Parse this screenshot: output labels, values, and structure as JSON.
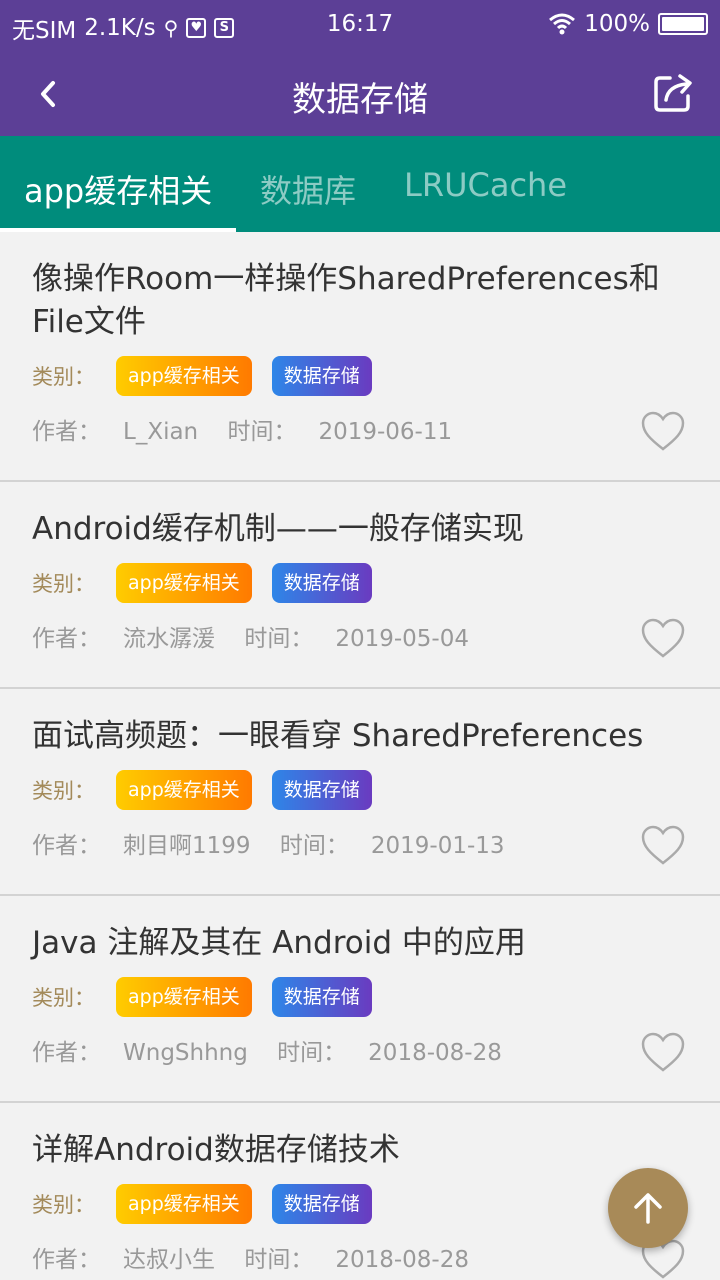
{
  "status_bar": {
    "carrier": "无SIM",
    "speed": "2.1K/s",
    "box_icon_1": "♥",
    "box_icon_2": "S",
    "time": "16:17",
    "battery": "100%"
  },
  "header": {
    "title": "数据存储",
    "back_icon": "chevron-left-icon",
    "share_icon": "share-icon"
  },
  "tabs": [
    {
      "label": "app缓存相关",
      "active": true
    },
    {
      "label": "数据库",
      "active": false
    },
    {
      "label": "LRUCache",
      "active": false
    }
  ],
  "category_label": "类别：",
  "author_prefix": "作者：",
  "time_prefix": "时间：",
  "articles": [
    {
      "title": "像操作Room一样操作SharedPreferences和File文件",
      "tags": [
        "app缓存相关",
        "数据存储"
      ],
      "author": "L_Xian",
      "date": "2019-06-11"
    },
    {
      "title": "Android缓存机制——一般存储实现",
      "tags": [
        "app缓存相关",
        "数据存储"
      ],
      "author": "流水潺湲",
      "date": "2019-05-04"
    },
    {
      "title": "面试高频题：一眼看穿 SharedPreferences",
      "tags": [
        "app缓存相关",
        "数据存储"
      ],
      "author": "刺目啊1199",
      "date": "2019-01-13"
    },
    {
      "title": "Java 注解及其在 Android 中的应用",
      "tags": [
        "app缓存相关",
        "数据存储"
      ],
      "author": "WngShhng",
      "date": "2018-08-28"
    },
    {
      "title": "详解Android数据存储技术",
      "tags": [
        "app缓存相关",
        "数据存储"
      ],
      "author": "达叔小生",
      "date": "2018-08-28"
    }
  ],
  "colors": {
    "header_bg": "#5c3f96",
    "tab_bg": "#008c7c",
    "fab_bg": "#a88a58"
  }
}
